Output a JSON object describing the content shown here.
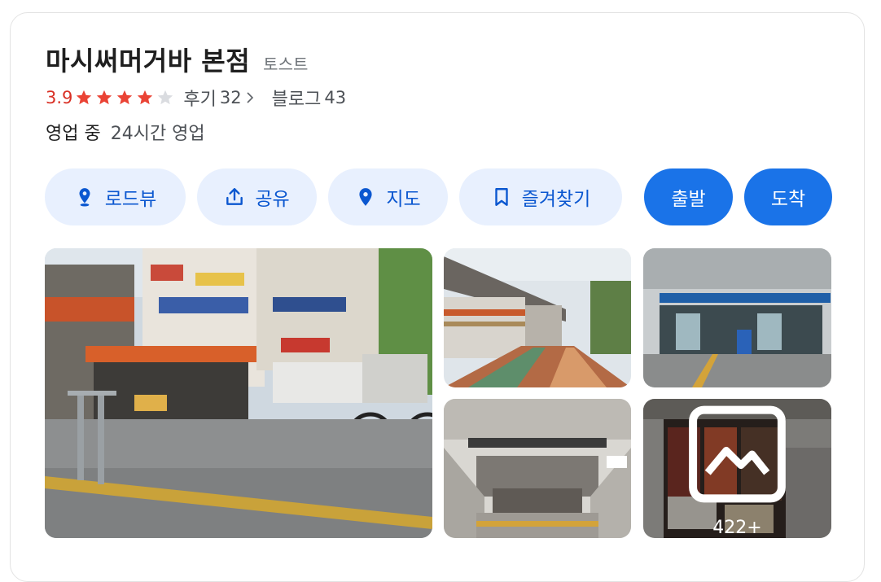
{
  "place": {
    "name": "마시써머거바 본점",
    "category": "토스트",
    "rating": "3.9",
    "rating_value": 3.9,
    "stars_max": 5,
    "reviews_label": "후기",
    "reviews_count": "32",
    "blog_label": "블로그",
    "blog_count": "43",
    "status": "영업 중",
    "hours": "24시간 영업"
  },
  "actions": [
    {
      "label": "로드뷰",
      "icon": "streetview-pin-icon"
    },
    {
      "label": "공유",
      "icon": "share-icon"
    },
    {
      "label": "지도",
      "icon": "map-pin-icon"
    },
    {
      "label": "즐겨찾기",
      "icon": "bookmark-icon"
    },
    {
      "label": "출발",
      "icon": ""
    },
    {
      "label": "도착",
      "icon": ""
    }
  ],
  "photos": {
    "more_count": "422+",
    "more_icon": "gallery-icon"
  },
  "colors": {
    "accent": "#1a73e8",
    "chip_bg": "#e8f0fe",
    "chip_text": "#0b57d0",
    "star": "#ea4335",
    "star_empty": "#dadce0",
    "rating_text": "#d93025"
  }
}
